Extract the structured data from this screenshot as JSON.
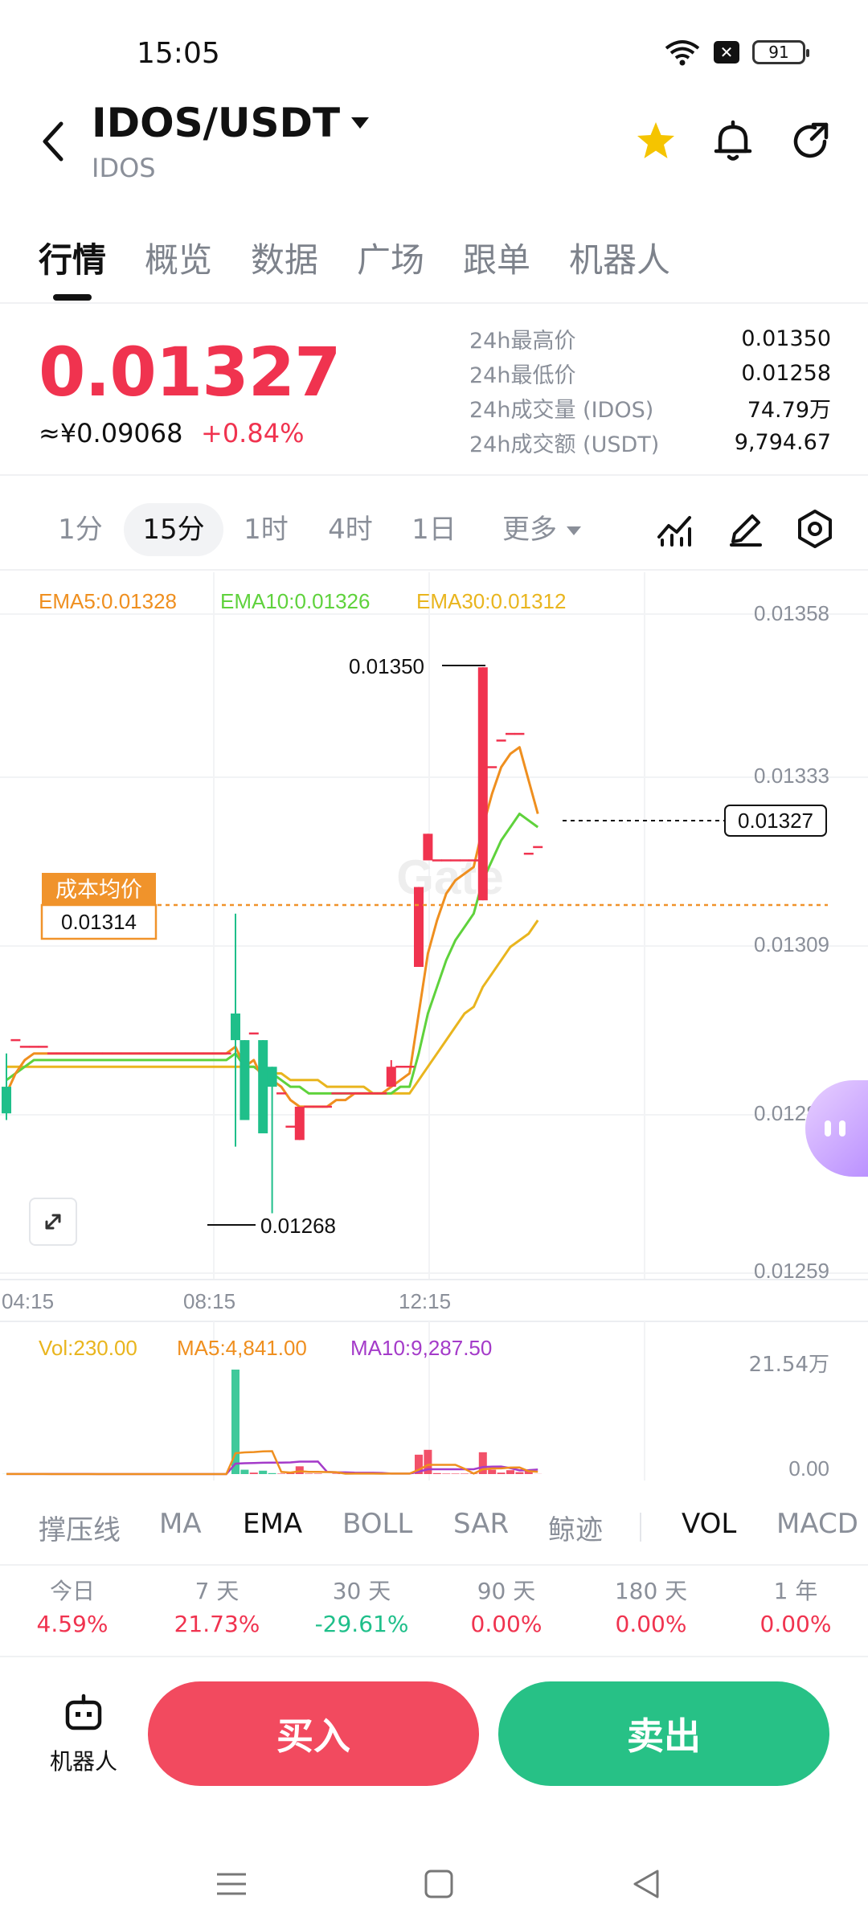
{
  "status_bar": {
    "time": "15:05",
    "battery": "91"
  },
  "header": {
    "pair": "IDOS/USDT",
    "base": "IDOS"
  },
  "tabs": [
    "行情",
    "概览",
    "数据",
    "广场",
    "跟单",
    "机器人"
  ],
  "price": {
    "last": "0.01327",
    "cny": "≈¥0.09068",
    "change": "+0.84%"
  },
  "stats": [
    {
      "label": "24h最高价",
      "value": "0.01350"
    },
    {
      "label": "24h最低价",
      "value": "0.01258"
    },
    {
      "label": "24h成交量 (IDOS)",
      "value": "74.79万"
    },
    {
      "label": "24h成交额 (USDT)",
      "value": "9,794.67"
    }
  ],
  "intervals": [
    "1分",
    "15分",
    "1时",
    "4时",
    "1日",
    "更多"
  ],
  "colors": {
    "up": "#f0334f",
    "down": "#1fbf8a",
    "ema5": "#ef8f1f",
    "ema10": "#5fd23c",
    "ema30": "#e9b51e",
    "ma10": "#a43bc9",
    "cost": "#f0932b"
  },
  "chart_data": {
    "type": "candlestick",
    "legend": [
      {
        "label": "EMA5:0.01328",
        "color": "#ef8f1f"
      },
      {
        "label": "EMA10:0.01326",
        "color": "#5fd23c"
      },
      {
        "label": "EMA30:0.01312",
        "color": "#e9b51e"
      }
    ],
    "ylim": [
      0.01259,
      0.01358
    ],
    "y_ticks": [
      "0.01358",
      "0.01333",
      "0.01309",
      "0.01284",
      "0.01259"
    ],
    "x_ticks": [
      "04:15",
      "08:15",
      "12:15"
    ],
    "high_label": "0.01350",
    "low_label": "0.01268",
    "current_price_label": "0.01327",
    "cost_label": "成本均价",
    "cost_value": "0.01314",
    "candles": [
      {
        "o": 0.01287,
        "h": 0.01292,
        "l": 0.01282,
        "c": 0.01283
      },
      {
        "o": 0.01294,
        "h": 0.01294,
        "l": 0.01294,
        "c": 0.01294
      },
      {
        "o": 0.01293,
        "h": 0.01293,
        "l": 0.01293,
        "c": 0.01293
      },
      {
        "o": 0.01293,
        "h": 0.01293,
        "l": 0.01293,
        "c": 0.01293
      },
      {
        "o": 0.01293,
        "h": 0.01293,
        "l": 0.01293,
        "c": 0.01293
      },
      {
        "o": 0.01292,
        "h": 0.01292,
        "l": 0.01292,
        "c": 0.01292
      },
      {
        "o": 0.01292,
        "h": 0.01292,
        "l": 0.01292,
        "c": 0.01292
      },
      {
        "o": 0.01292,
        "h": 0.01292,
        "l": 0.01292,
        "c": 0.01292
      },
      {
        "o": 0.01292,
        "h": 0.01292,
        "l": 0.01292,
        "c": 0.01292
      },
      {
        "o": 0.01292,
        "h": 0.01292,
        "l": 0.01292,
        "c": 0.01292
      },
      {
        "o": 0.01292,
        "h": 0.01292,
        "l": 0.01292,
        "c": 0.01292
      },
      {
        "o": 0.01292,
        "h": 0.01292,
        "l": 0.01292,
        "c": 0.01292
      },
      {
        "o": 0.01292,
        "h": 0.01292,
        "l": 0.01292,
        "c": 0.01292
      },
      {
        "o": 0.01292,
        "h": 0.01292,
        "l": 0.01292,
        "c": 0.01292
      },
      {
        "o": 0.01292,
        "h": 0.01292,
        "l": 0.01292,
        "c": 0.01292
      },
      {
        "o": 0.01292,
        "h": 0.01292,
        "l": 0.01292,
        "c": 0.01292
      },
      {
        "o": 0.01292,
        "h": 0.01292,
        "l": 0.01292,
        "c": 0.01292
      },
      {
        "o": 0.01292,
        "h": 0.01292,
        "l": 0.01292,
        "c": 0.01292
      },
      {
        "o": 0.01292,
        "h": 0.01292,
        "l": 0.01292,
        "c": 0.01292
      },
      {
        "o": 0.01292,
        "h": 0.01292,
        "l": 0.01292,
        "c": 0.01292
      },
      {
        "o": 0.01292,
        "h": 0.01292,
        "l": 0.01292,
        "c": 0.01292
      },
      {
        "o": 0.01292,
        "h": 0.01292,
        "l": 0.01292,
        "c": 0.01292
      },
      {
        "o": 0.01292,
        "h": 0.01292,
        "l": 0.01292,
        "c": 0.01292
      },
      {
        "o": 0.01292,
        "h": 0.01292,
        "l": 0.01292,
        "c": 0.01292
      },
      {
        "o": 0.01292,
        "h": 0.01292,
        "l": 0.01292,
        "c": 0.01292
      },
      {
        "o": 0.01298,
        "h": 0.01313,
        "l": 0.01278,
        "c": 0.01294
      },
      {
        "o": 0.01294,
        "h": 0.01294,
        "l": 0.01282,
        "c": 0.01282
      },
      {
        "o": 0.01295,
        "h": 0.01295,
        "l": 0.01295,
        "c": 0.01295
      },
      {
        "o": 0.01294,
        "h": 0.01294,
        "l": 0.0128,
        "c": 0.0128
      },
      {
        "o": 0.0129,
        "h": 0.0129,
        "l": 0.01268,
        "c": 0.01287
      },
      {
        "o": 0.01286,
        "h": 0.01286,
        "l": 0.01286,
        "c": 0.01286
      },
      {
        "o": 0.01281,
        "h": 0.01281,
        "l": 0.01281,
        "c": 0.01281
      },
      {
        "o": 0.01279,
        "h": 0.01284,
        "l": 0.01279,
        "c": 0.01284
      },
      {
        "o": 0.01284,
        "h": 0.01284,
        "l": 0.01284,
        "c": 0.01284
      },
      {
        "o": 0.01284,
        "h": 0.01284,
        "l": 0.01284,
        "c": 0.01284
      },
      {
        "o": 0.01284,
        "h": 0.01284,
        "l": 0.01284,
        "c": 0.01284
      },
      {
        "o": 0.01286,
        "h": 0.01286,
        "l": 0.01286,
        "c": 0.01286
      },
      {
        "o": 0.01286,
        "h": 0.01286,
        "l": 0.01286,
        "c": 0.01286
      },
      {
        "o": 0.01286,
        "h": 0.01286,
        "l": 0.01286,
        "c": 0.01286
      },
      {
        "o": 0.01286,
        "h": 0.01286,
        "l": 0.01286,
        "c": 0.01286
      },
      {
        "o": 0.01286,
        "h": 0.01286,
        "l": 0.01286,
        "c": 0.01286
      },
      {
        "o": 0.01286,
        "h": 0.01286,
        "l": 0.01286,
        "c": 0.01286
      },
      {
        "o": 0.01287,
        "h": 0.01291,
        "l": 0.01287,
        "c": 0.0129
      },
      {
        "o": 0.0129,
        "h": 0.0129,
        "l": 0.0129,
        "c": 0.0129
      },
      {
        "o": 0.0129,
        "h": 0.0129,
        "l": 0.0129,
        "c": 0.0129
      },
      {
        "o": 0.01305,
        "h": 0.01317,
        "l": 0.01305,
        "c": 0.01317
      },
      {
        "o": 0.01321,
        "h": 0.01325,
        "l": 0.01321,
        "c": 0.01325
      },
      {
        "o": 0.01321,
        "h": 0.01321,
        "l": 0.01321,
        "c": 0.01321
      },
      {
        "o": 0.01321,
        "h": 0.01321,
        "l": 0.01321,
        "c": 0.01321
      },
      {
        "o": 0.01321,
        "h": 0.01321,
        "l": 0.01321,
        "c": 0.01321
      },
      {
        "o": 0.01321,
        "h": 0.01321,
        "l": 0.01321,
        "c": 0.01321
      },
      {
        "o": 0.01321,
        "h": 0.01321,
        "l": 0.01321,
        "c": 0.01321
      },
      {
        "o": 0.01315,
        "h": 0.0135,
        "l": 0.01315,
        "c": 0.0135
      },
      {
        "o": 0.01335,
        "h": 0.01335,
        "l": 0.01335,
        "c": 0.01335
      },
      {
        "o": 0.01339,
        "h": 0.01339,
        "l": 0.01339,
        "c": 0.01339
      },
      {
        "o": 0.0134,
        "h": 0.0134,
        "l": 0.0134,
        "c": 0.0134
      },
      {
        "o": 0.0134,
        "h": 0.0134,
        "l": 0.0134,
        "c": 0.0134
      },
      {
        "o": 0.01322,
        "h": 0.01322,
        "l": 0.01322,
        "c": 0.01322
      },
      {
        "o": 0.01323,
        "h": 0.01323,
        "l": 0.01323,
        "c": 0.01323
      }
    ],
    "ema5": [
      0.01286,
      0.01289,
      0.01291,
      0.01292,
      0.01292,
      0.01292,
      0.01292,
      0.01292,
      0.01292,
      0.01292,
      0.01292,
      0.01292,
      0.01292,
      0.01292,
      0.01292,
      0.01292,
      0.01292,
      0.01292,
      0.01292,
      0.01292,
      0.01292,
      0.01292,
      0.01292,
      0.01292,
      0.01292,
      0.01293,
      0.0129,
      0.01291,
      0.01288,
      0.01288,
      0.01287,
      0.01285,
      0.01284,
      0.01284,
      0.01284,
      0.01284,
      0.01285,
      0.01285,
      0.01286,
      0.01286,
      0.01286,
      0.01286,
      0.01287,
      0.01288,
      0.01289,
      0.01298,
      0.01307,
      0.01312,
      0.01316,
      0.01318,
      0.01319,
      0.0132,
      0.01326,
      0.01331,
      0.01335,
      0.01337,
      0.01338,
      0.01333,
      0.01328
    ],
    "ema10": [
      0.01288,
      0.01289,
      0.0129,
      0.01291,
      0.01291,
      0.01291,
      0.01291,
      0.01291,
      0.01291,
      0.01291,
      0.01291,
      0.01291,
      0.01291,
      0.01291,
      0.01291,
      0.01291,
      0.01291,
      0.01291,
      0.01291,
      0.01291,
      0.01291,
      0.01291,
      0.01291,
      0.01291,
      0.01291,
      0.01292,
      0.0129,
      0.0129,
      0.01289,
      0.01289,
      0.01288,
      0.01287,
      0.01287,
      0.01286,
      0.01286,
      0.01286,
      0.01286,
      0.01286,
      0.01286,
      0.01286,
      0.01286,
      0.01286,
      0.01286,
      0.01287,
      0.01287,
      0.01292,
      0.01298,
      0.01302,
      0.01306,
      0.01309,
      0.01311,
      0.01313,
      0.01318,
      0.01321,
      0.01324,
      0.01326,
      0.01328,
      0.01327,
      0.01326
    ],
    "ema30": [
      0.0129,
      0.0129,
      0.0129,
      0.0129,
      0.0129,
      0.0129,
      0.0129,
      0.0129,
      0.0129,
      0.0129,
      0.0129,
      0.0129,
      0.0129,
      0.0129,
      0.0129,
      0.0129,
      0.0129,
      0.0129,
      0.0129,
      0.0129,
      0.0129,
      0.0129,
      0.0129,
      0.0129,
      0.0129,
      0.0129,
      0.0129,
      0.0129,
      0.01289,
      0.01289,
      0.01289,
      0.01288,
      0.01288,
      0.01288,
      0.01288,
      0.01287,
      0.01287,
      0.01287,
      0.01287,
      0.01287,
      0.01286,
      0.01286,
      0.01286,
      0.01286,
      0.01286,
      0.01288,
      0.0129,
      0.01292,
      0.01294,
      0.01296,
      0.01298,
      0.01299,
      0.01302,
      0.01304,
      0.01306,
      0.01308,
      0.01309,
      0.0131,
      0.01312
    ],
    "volume": {
      "legend": [
        {
          "label": "Vol:230.00",
          "color": "#e9b51e"
        },
        {
          "label": "MA5:4,841.00",
          "color": "#ef8f1f"
        },
        {
          "label": "MA10:9,287.50",
          "color": "#a43bc9"
        }
      ],
      "ylim": [
        0,
        215400
      ],
      "y_ticks": [
        "21.54万",
        "0.00"
      ],
      "values": [
        200,
        0,
        0,
        0,
        0,
        0,
        0,
        0,
        0,
        0,
        0,
        0,
        0,
        0,
        0,
        0,
        0,
        0,
        0,
        0,
        0,
        0,
        0,
        0,
        0,
        215400,
        9000,
        3000,
        7000,
        2000,
        1000,
        3000,
        16000,
        1000,
        1000,
        0,
        1000,
        1000,
        1000,
        1000,
        1000,
        0,
        2000,
        1000,
        1000,
        40000,
        50000,
        2000,
        1000,
        1000,
        1000,
        1000,
        45000,
        9000,
        3000,
        8000,
        4000,
        6000,
        230
      ],
      "ma5": [
        200,
        200,
        200,
        200,
        200,
        0,
        0,
        0,
        0,
        0,
        0,
        0,
        0,
        0,
        0,
        0,
        0,
        0,
        0,
        0,
        0,
        0,
        0,
        0,
        0,
        43000,
        44800,
        45400,
        46800,
        47300,
        4400,
        3200,
        5800,
        4600,
        4400,
        4200,
        4000,
        800,
        1000,
        1000,
        1000,
        800,
        1000,
        1000,
        1000,
        9000,
        19000,
        19000,
        19000,
        19000,
        11000,
        1200,
        9800,
        11600,
        11800,
        13400,
        13600,
        6000,
        4841
      ],
      "ma10": [
        200,
        200,
        200,
        200,
        200,
        200,
        200,
        200,
        200,
        200,
        0,
        0,
        0,
        0,
        0,
        0,
        0,
        0,
        0,
        0,
        0,
        0,
        0,
        0,
        0,
        21500,
        22400,
        22700,
        23400,
        23600,
        23700,
        24000,
        25600,
        25700,
        25800,
        4400,
        3600,
        3400,
        2800,
        2700,
        2700,
        2400,
        1000,
        1000,
        1000,
        5000,
        9900,
        10000,
        10000,
        10000,
        10000,
        10000,
        14500,
        15300,
        15500,
        12300,
        7700,
        8100,
        9287
      ]
    }
  },
  "indicators": [
    "撑压线",
    "MA",
    "EMA",
    "BOLL",
    "SAR",
    "鲸迹",
    "VOL",
    "MACD"
  ],
  "returns": [
    {
      "label": "今日",
      "value": "4.59%",
      "dir": "up"
    },
    {
      "label": "7 天",
      "value": "21.73%",
      "dir": "up"
    },
    {
      "label": "30 天",
      "value": "-29.61%",
      "dir": "down"
    },
    {
      "label": "90 天",
      "value": "0.00%",
      "dir": "up"
    },
    {
      "label": "180 天",
      "value": "0.00%",
      "dir": "up"
    },
    {
      "label": "1 年",
      "value": "0.00%",
      "dir": "up"
    }
  ],
  "actions": {
    "bot": "机器人",
    "buy": "买入",
    "sell": "卖出"
  }
}
